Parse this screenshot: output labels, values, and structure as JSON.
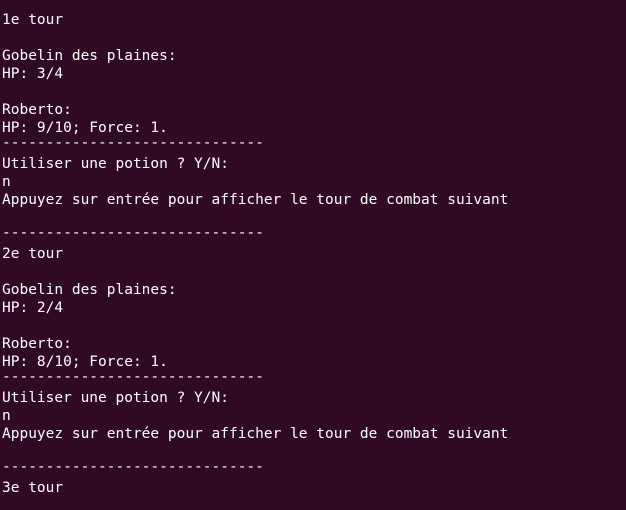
{
  "terminal": {
    "lines": [
      {
        "kind": "separator",
        "text": "------------------------------"
      },
      {
        "kind": "text",
        "text": "1e tour"
      },
      {
        "kind": "blank",
        "text": ""
      },
      {
        "kind": "text",
        "text": "Gobelin des plaines:"
      },
      {
        "kind": "text",
        "text": "HP: 3/4"
      },
      {
        "kind": "blank",
        "text": ""
      },
      {
        "kind": "text",
        "text": "Roberto:"
      },
      {
        "kind": "text",
        "text": "HP: 9/10; Force: 1."
      },
      {
        "kind": "separator",
        "text": "------------------------------"
      },
      {
        "kind": "text",
        "text": "Utiliser une potion ? Y/N:"
      },
      {
        "kind": "input",
        "text": "n"
      },
      {
        "kind": "text",
        "text": "Appuyez sur entrée pour afficher le tour de combat suivant"
      },
      {
        "kind": "blank",
        "text": ""
      },
      {
        "kind": "separator",
        "text": "------------------------------"
      },
      {
        "kind": "text",
        "text": "2e tour"
      },
      {
        "kind": "blank",
        "text": ""
      },
      {
        "kind": "text",
        "text": "Gobelin des plaines:"
      },
      {
        "kind": "text",
        "text": "HP: 2/4"
      },
      {
        "kind": "blank",
        "text": ""
      },
      {
        "kind": "text",
        "text": "Roberto:"
      },
      {
        "kind": "text",
        "text": "HP: 8/10; Force: 1."
      },
      {
        "kind": "separator",
        "text": "------------------------------"
      },
      {
        "kind": "text",
        "text": "Utiliser une potion ? Y/N:"
      },
      {
        "kind": "input",
        "text": "n"
      },
      {
        "kind": "text",
        "text": "Appuyez sur entrée pour afficher le tour de combat suivant"
      },
      {
        "kind": "blank",
        "text": ""
      },
      {
        "kind": "separator",
        "text": "------------------------------"
      },
      {
        "kind": "text",
        "text": "3e tour"
      }
    ]
  },
  "colors": {
    "background": "#300a24",
    "foreground": "#ffffff"
  }
}
